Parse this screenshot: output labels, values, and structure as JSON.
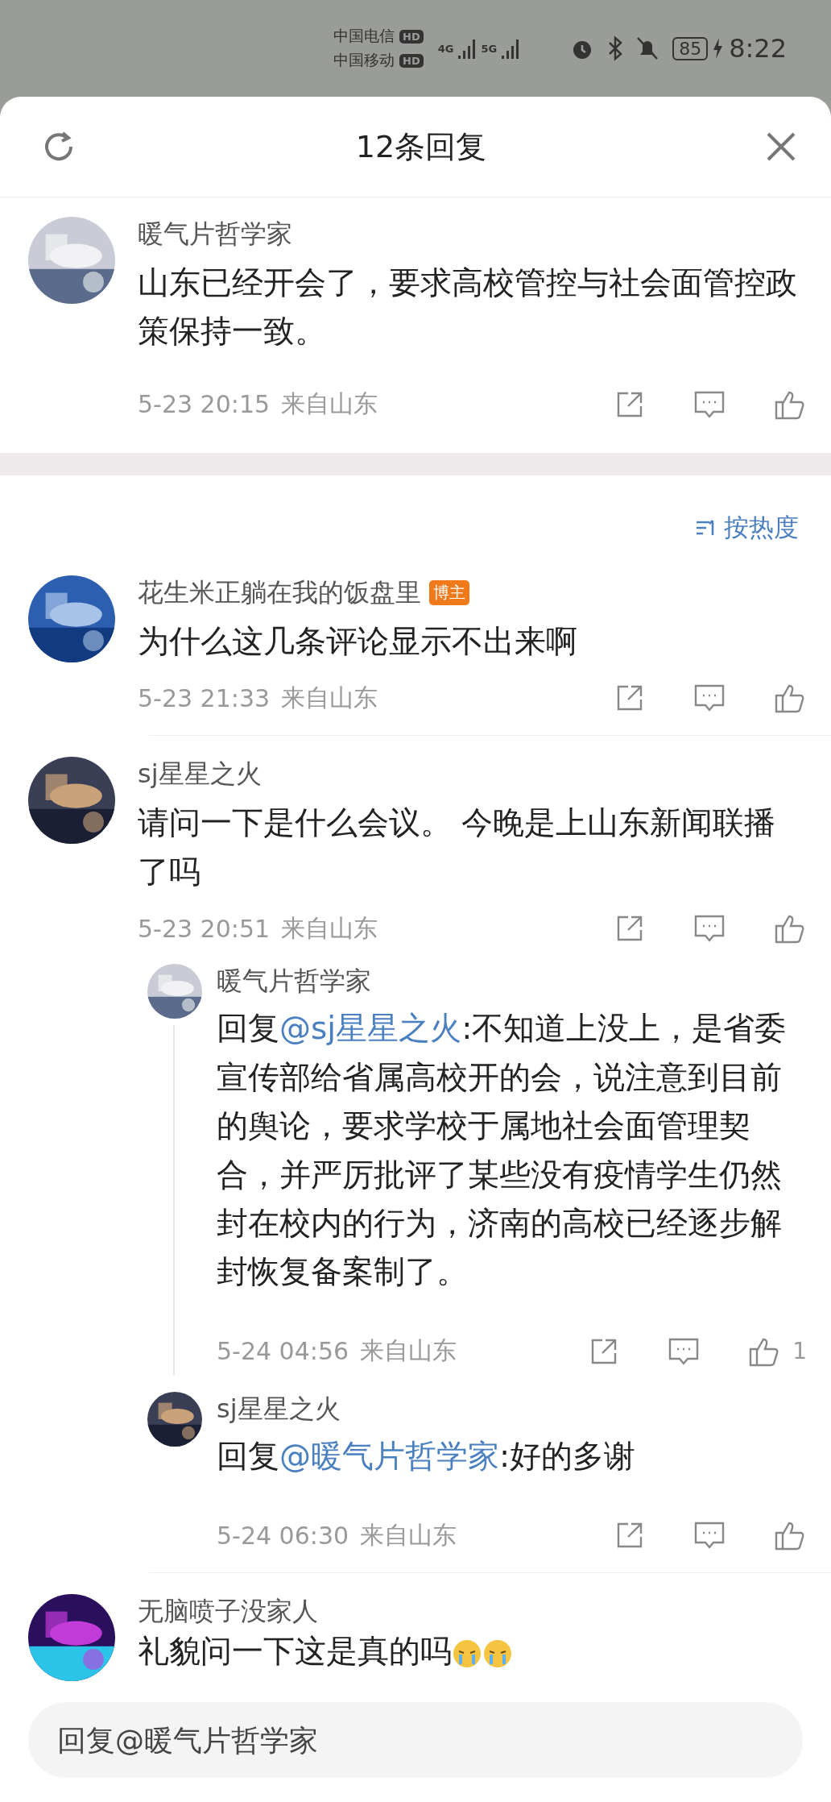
{
  "status_bar": {
    "carriers": [
      {
        "name": "中国电信",
        "badge": "HD"
      },
      {
        "name": "中国移动",
        "badge": "HD"
      }
    ],
    "networks": [
      "4G",
      "5G"
    ],
    "battery": "85",
    "time": "8:22"
  },
  "header": {
    "title": "12条回复"
  },
  "main_comment": {
    "author": "暖气片哲学家",
    "text": "山东已经开会了，要求高校管控与社会面管控政策保持一致。",
    "time": "5-23 20:15",
    "location": "来自山东"
  },
  "sort": {
    "label": "按热度"
  },
  "comments": [
    {
      "author": "花生米正躺在我的饭盘里",
      "badge": "博主",
      "text": "为什么这几条评论显示不出来啊",
      "time": "5-23 21:33",
      "location": "来自山东"
    },
    {
      "author": "sj星星之火",
      "text": "请问一下是什么会议。 今晚是上山东新闻联播了吗",
      "time": "5-23 20:51",
      "location": "来自山东",
      "replies": [
        {
          "author": "暖气片哲学家",
          "prefix": "回复",
          "mention": "@sj星星之火",
          "text": ":不知道上没上，是省委宣传部给省属高校开的会，说注意到目前的舆论，要求学校于属地社会面管理契合，并严厉批评了某些没有疫情学生仍然封在校内的行为，济南的高校已经逐步解封恢复备案制了。",
          "time": "5-24 04:56",
          "location": "来自山东",
          "likes": "1"
        },
        {
          "author": "sj星星之火",
          "prefix": "回复",
          "mention": "@暖气片哲学家",
          "text": ":好的多谢",
          "time": "5-24 06:30",
          "location": "来自山东"
        }
      ]
    },
    {
      "author": "无脑喷子没家人",
      "text": "礼貌问一下这是真的吗",
      "emojis": [
        {
          "kind": "crying"
        },
        {
          "kind": "crying"
        }
      ]
    }
  ],
  "reply_input": {
    "placeholder": "回复@暖气片哲学家"
  }
}
